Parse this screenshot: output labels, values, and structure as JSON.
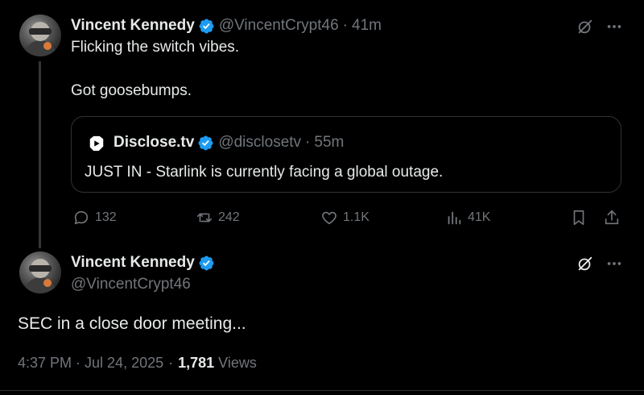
{
  "thread_tweet": {
    "author": {
      "display_name": "Vincent Kennedy",
      "handle": "@VincentCrypt46"
    },
    "time": "41m",
    "lines": [
      "Flicking the switch vibes.",
      "Got goosebumps."
    ],
    "quote": {
      "author": {
        "display_name": "Disclose.tv",
        "handle": "@disclosetv"
      },
      "time": "55m",
      "text": "JUST IN - Starlink is currently facing a global outage."
    },
    "actions": {
      "replies": "132",
      "reposts": "242",
      "likes": "1.1K",
      "views": "41K"
    }
  },
  "main_tweet": {
    "author": {
      "display_name": "Vincent Kennedy",
      "handle": "@VincentCrypt46"
    },
    "text": "SEC in a close door meeting...",
    "timestamp": "4:37 PM · Jul 24, 2025",
    "views_count": "1,781",
    "views_label": "Views"
  },
  "separator": "·",
  "colors": {
    "background": "#000000",
    "text_primary": "#e7e9ea",
    "text_secondary": "#71767b",
    "verified_blue": "#1d9bf0",
    "border": "#2f3336"
  },
  "icons": {
    "verified": "verified-badge-icon",
    "grok": "grok-icon",
    "more": "more-icon",
    "reply": "reply-icon",
    "repost": "repost-icon",
    "like": "heart-icon",
    "views": "analytics-icon",
    "bookmark": "bookmark-icon",
    "share": "share-icon",
    "quote_logo": "disclose-logo-icon"
  }
}
